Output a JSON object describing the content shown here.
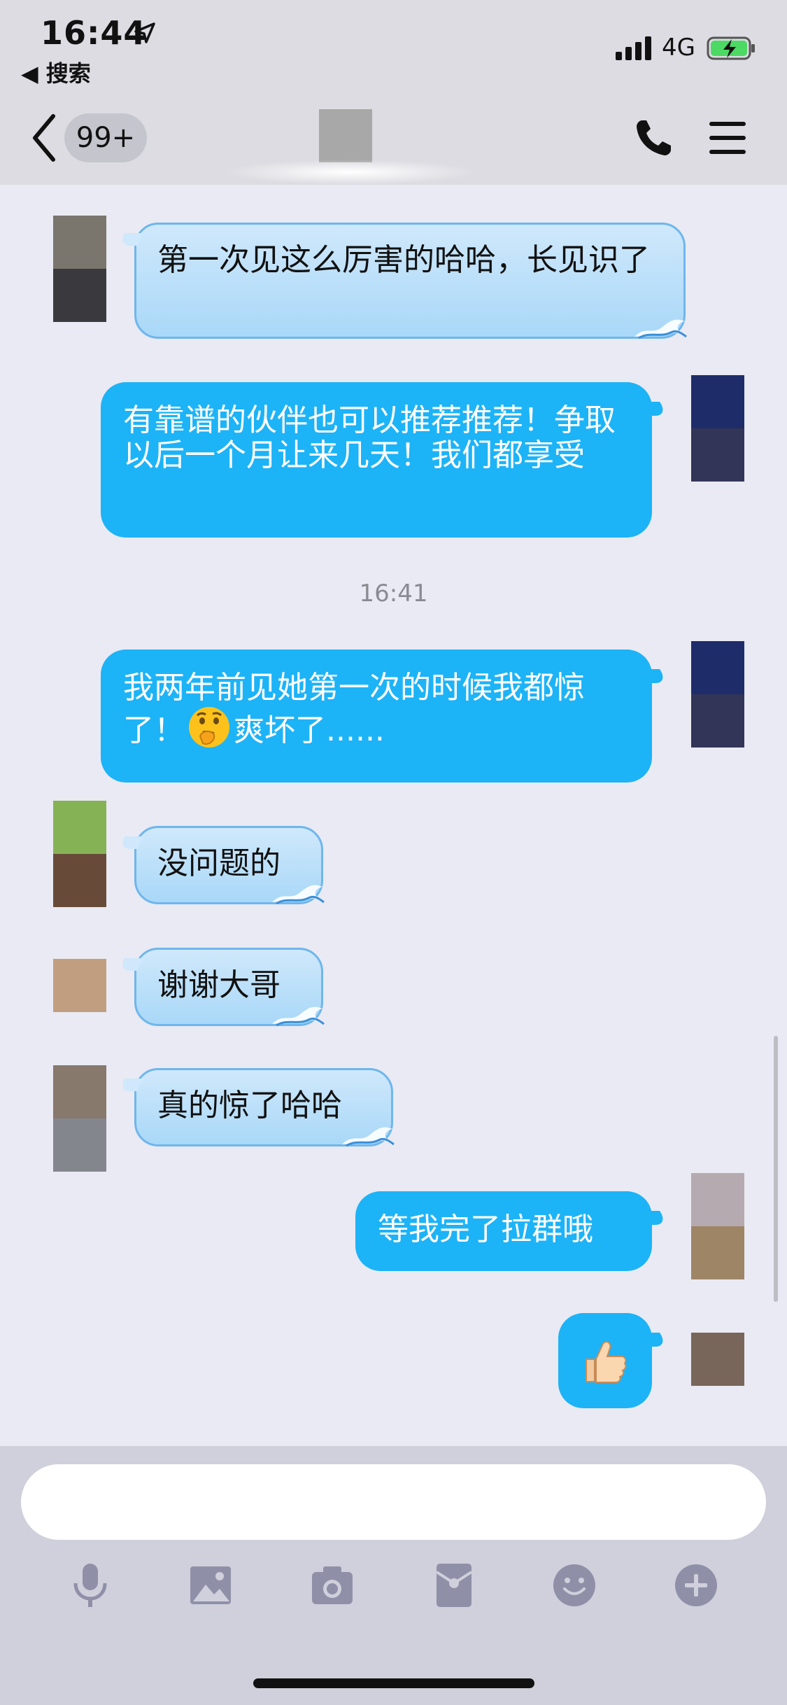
{
  "status": {
    "time": "16:44",
    "back_app": "◀ 搜索",
    "network": "4G"
  },
  "header": {
    "unread_badge": "99+"
  },
  "messages": [
    {
      "side": "left",
      "text": "第一次见这么厉害的哈哈，长见识了"
    },
    {
      "side": "right",
      "text": "有靠谱的伙伴也可以推荐推荐！争取以后一个月让来几天！我们都享受"
    },
    {
      "side": "right",
      "text_before": "我两年前见她第一次的时候我都惊了！",
      "emoji": "thinking-face",
      "text_after": "爽坏了......"
    },
    {
      "side": "left",
      "text": "没问题的"
    },
    {
      "side": "left",
      "text": "谢谢大哥"
    },
    {
      "side": "left",
      "text": "真的惊了哈哈"
    },
    {
      "side": "right",
      "text": "等我完了拉群哦"
    },
    {
      "side": "right",
      "emoji": "thumbs-up"
    }
  ],
  "timestamp": "16:41",
  "toolbar": {
    "items": [
      "microphone-icon",
      "image-icon",
      "camera-icon",
      "red-packet-icon",
      "emoji-icon",
      "plus-icon"
    ]
  },
  "colors": {
    "right_bubble": "#1db3f7",
    "left_bubble": "#bfe2fa",
    "background": "#e9eaf3",
    "toolbar_icon": "#8f90a8"
  }
}
